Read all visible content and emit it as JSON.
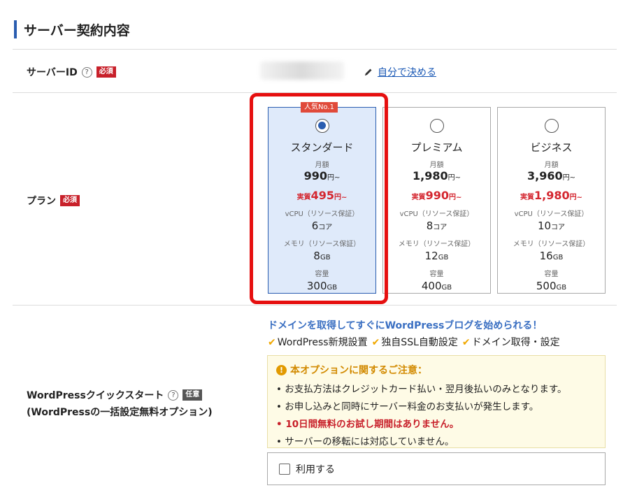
{
  "section": {
    "title": "サーバー契約内容"
  },
  "server_id": {
    "label": "サーバーID",
    "help": "?",
    "required": "必須",
    "self_link": "自分で決める"
  },
  "plan": {
    "label": "プラン",
    "required": "必須",
    "popular_tag": "人気No.1",
    "monthly_label": "月額",
    "real_prefix": "実質",
    "vcpu_label": "vCPU（リソース保証）",
    "memory_label": "メモリ（リソース保証）",
    "storage_label": "容量",
    "yen_suffix": "円~",
    "core_unit": "コア",
    "gb_unit": "GB",
    "items": [
      {
        "name": "スタンダード",
        "price": "990",
        "real": "495",
        "vcpu": "6",
        "memory": "8",
        "storage": "300",
        "selected": true
      },
      {
        "name": "プレミアム",
        "price": "1,980",
        "real": "990",
        "vcpu": "8",
        "memory": "12",
        "storage": "400",
        "selected": false
      },
      {
        "name": "ビジネス",
        "price": "3,960",
        "real": "1,980",
        "vcpu": "10",
        "memory": "16",
        "storage": "500",
        "selected": false
      }
    ]
  },
  "wordpress": {
    "label_line1": "WordPressクイックスタート",
    "label_line2": "(WordPressの一括設定無料オプション)",
    "help": "?",
    "optional": "任意",
    "headline": "ドメインを取得してすぐにWordPressブログを始められる！",
    "features": [
      "WordPress新規設置",
      "独自SSL自動設定",
      "ドメイン取得・設定"
    ],
    "notice_title": "本オプションに関するご注意：",
    "notices": [
      "お支払方法はクレジットカード払い・翌月後払いのみとなります。",
      "お申し込みと同時にサーバー料金のお支払いが発生します。",
      "10日間無料のお試し期間はありません。",
      "サーバーの移転には対応していません。"
    ],
    "use_label": "利用する"
  },
  "colors": {
    "accent": "#2a5db0",
    "required": "#c8202a",
    "highlight": "#e61010",
    "warning": "#d28a00"
  }
}
